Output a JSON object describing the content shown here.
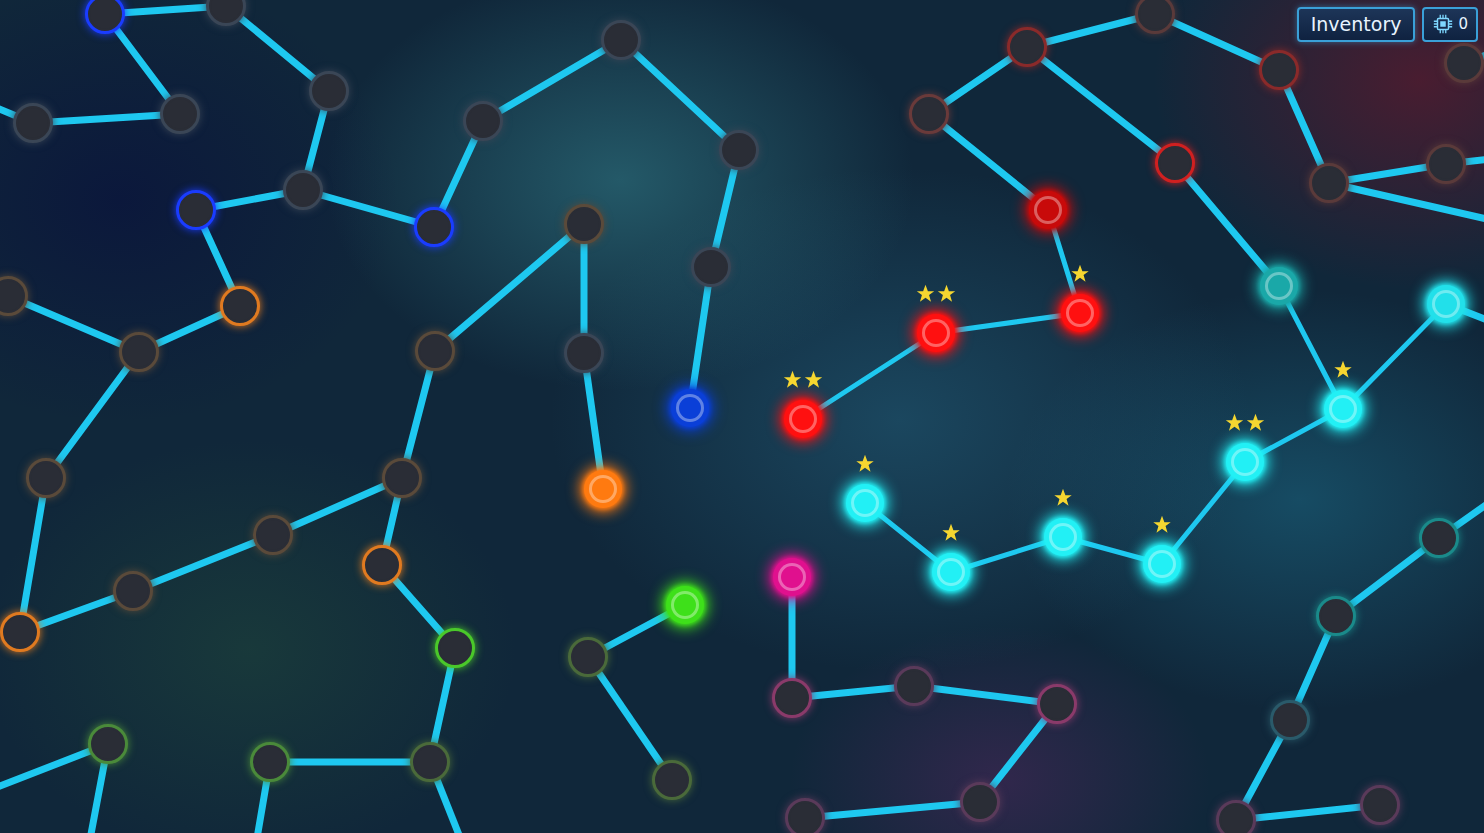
{
  "hud": {
    "inventory_label": "Inventory",
    "chips": "0"
  },
  "map": {
    "nodes": [
      {
        "lit": true,
        "color": "#0a3fd8",
        "stars": 0
      },
      {
        "lit": true,
        "color": "#ff1010",
        "stars": 2
      },
      {
        "lit": true,
        "color": "#ff1010",
        "stars": 2
      },
      {
        "lit": true,
        "color": "#ff1010",
        "stars": 1
      },
      {
        "lit": true,
        "color": "#c80a0a",
        "stars": 0
      },
      {
        "lit": true,
        "color": "#ff7a10",
        "stars": 0
      },
      {
        "lit": true,
        "color": "#3ee01a",
        "stars": 0
      },
      {
        "lit": true,
        "color": "#e0108e",
        "stars": 0
      },
      {
        "lit": true,
        "color": "#22f0f5",
        "stars": 1
      },
      {
        "lit": true,
        "color": "#22f0f5",
        "stars": 1
      },
      {
        "lit": true,
        "color": "#22f0f5",
        "stars": 1
      },
      {
        "lit": true,
        "color": "#22f0f5",
        "stars": 1
      },
      {
        "lit": true,
        "color": "#22f0f5",
        "stars": 2
      },
      {
        "lit": true,
        "color": "#22f0f5",
        "stars": 1
      },
      {
        "lit": true,
        "color": "#22e0ea",
        "stars": 0
      },
      {
        "lit": true,
        "color": "#1aa8a8",
        "stars": 0
      },
      {
        "lit": false,
        "color": "#1a3cff",
        "stars": 0
      },
      {
        "lit": false,
        "color": "#3a4656",
        "stars": 0
      },
      {
        "lit": false,
        "color": "#3a4656",
        "stars": 0
      },
      {
        "lit": false,
        "color": "#3a4656",
        "stars": 0
      },
      {
        "lit": false,
        "color": "#3a4656",
        "stars": 0
      },
      {
        "lit": false,
        "color": "#1a3cff",
        "stars": 0
      },
      {
        "lit": false,
        "color": "#3a4656",
        "stars": 0
      },
      {
        "lit": false,
        "color": "#1a3cff",
        "stars": 0
      },
      {
        "lit": false,
        "color": "#3a4656",
        "stars": 0
      },
      {
        "lit": false,
        "color": "#3a4656",
        "stars": 0
      },
      {
        "lit": false,
        "color": "#3a4656",
        "stars": 0
      },
      {
        "lit": false,
        "color": "#3a4656",
        "stars": 0
      },
      {
        "lit": false,
        "color": "#5a4a3a",
        "stars": 0
      },
      {
        "lit": false,
        "color": "#3a4656",
        "stars": 0
      },
      {
        "lit": false,
        "color": "#5a4a3a",
        "stars": 0
      },
      {
        "lit": false,
        "color": "#e07a20",
        "stars": 0
      },
      {
        "lit": false,
        "color": "#5a4a3a",
        "stars": 0
      },
      {
        "lit": false,
        "color": "#5a4a3a",
        "stars": 0
      },
      {
        "lit": false,
        "color": "#5a4a3a",
        "stars": 0
      },
      {
        "lit": false,
        "color": "#5a4a3a",
        "stars": 0
      },
      {
        "lit": false,
        "color": "#5a4a3a",
        "stars": 0
      },
      {
        "lit": false,
        "color": "#e07a20",
        "stars": 0
      },
      {
        "lit": false,
        "color": "#5a4a3a",
        "stars": 0
      },
      {
        "lit": false,
        "color": "#e07a20",
        "stars": 0
      },
      {
        "lit": false,
        "color": "#4ac82a",
        "stars": 0
      },
      {
        "lit": false,
        "color": "#4a8a3a",
        "stars": 0
      },
      {
        "lit": false,
        "color": "#4a8a3a",
        "stars": 0
      },
      {
        "lit": false,
        "color": "#4a6a3a",
        "stars": 0
      },
      {
        "lit": false,
        "color": "#4a6a3a",
        "stars": 0
      },
      {
        "lit": false,
        "color": "#4a6a3a",
        "stars": 0
      },
      {
        "lit": false,
        "color": "#8a3a6a",
        "stars": 0
      },
      {
        "lit": false,
        "color": "#5a3a5a",
        "stars": 0
      },
      {
        "lit": false,
        "color": "#8a3a6a",
        "stars": 0
      },
      {
        "lit": false,
        "color": "#5a3a5a",
        "stars": 0
      },
      {
        "lit": false,
        "color": "#5a3a5a",
        "stars": 0
      },
      {
        "lit": false,
        "color": "#6a3a3a",
        "stars": 0
      },
      {
        "lit": false,
        "color": "#8a2a2a",
        "stars": 0
      },
      {
        "lit": false,
        "color": "#5a3a3a",
        "stars": 0
      },
      {
        "lit": false,
        "color": "#8a2a2a",
        "stars": 0
      },
      {
        "lit": false,
        "color": "#d02020",
        "stars": 0
      },
      {
        "lit": false,
        "color": "#5a3a3a",
        "stars": 0
      },
      {
        "lit": false,
        "color": "#5a3a3a",
        "stars": 0
      },
      {
        "lit": false,
        "color": "#5a3a3a",
        "stars": 0
      },
      {
        "lit": false,
        "color": "#1a8a8a",
        "stars": 0
      },
      {
        "lit": false,
        "color": "#1a8a8a",
        "stars": 0
      },
      {
        "lit": false,
        "color": "#2a5a6a",
        "stars": 0
      },
      {
        "lit": false,
        "color": "#5a3a5a",
        "stars": 0
      },
      {
        "lit": false,
        "color": "#5a3a5a",
        "stars": 0
      }
    ]
  }
}
